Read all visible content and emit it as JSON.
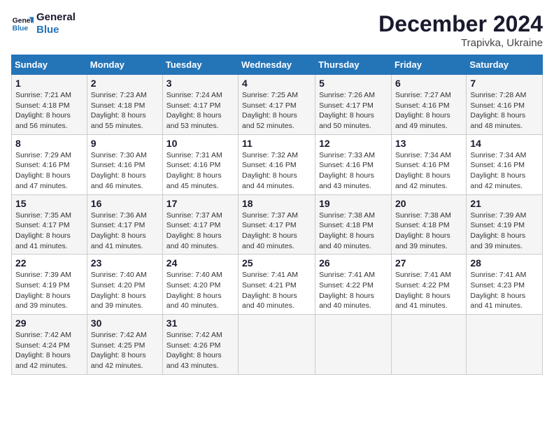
{
  "logo": {
    "line1": "General",
    "line2": "Blue"
  },
  "title": "December 2024",
  "subtitle": "Trapivka, Ukraine",
  "days_of_week": [
    "Sunday",
    "Monday",
    "Tuesday",
    "Wednesday",
    "Thursday",
    "Friday",
    "Saturday"
  ],
  "weeks": [
    [
      {
        "day": "1",
        "sunrise": "7:21 AM",
        "sunset": "4:18 PM",
        "daylight": "8 hours and 56 minutes."
      },
      {
        "day": "2",
        "sunrise": "7:23 AM",
        "sunset": "4:18 PM",
        "daylight": "8 hours and 55 minutes."
      },
      {
        "day": "3",
        "sunrise": "7:24 AM",
        "sunset": "4:17 PM",
        "daylight": "8 hours and 53 minutes."
      },
      {
        "day": "4",
        "sunrise": "7:25 AM",
        "sunset": "4:17 PM",
        "daylight": "8 hours and 52 minutes."
      },
      {
        "day": "5",
        "sunrise": "7:26 AM",
        "sunset": "4:17 PM",
        "daylight": "8 hours and 50 minutes."
      },
      {
        "day": "6",
        "sunrise": "7:27 AM",
        "sunset": "4:16 PM",
        "daylight": "8 hours and 49 minutes."
      },
      {
        "day": "7",
        "sunrise": "7:28 AM",
        "sunset": "4:16 PM",
        "daylight": "8 hours and 48 minutes."
      }
    ],
    [
      {
        "day": "8",
        "sunrise": "7:29 AM",
        "sunset": "4:16 PM",
        "daylight": "8 hours and 47 minutes."
      },
      {
        "day": "9",
        "sunrise": "7:30 AM",
        "sunset": "4:16 PM",
        "daylight": "8 hours and 46 minutes."
      },
      {
        "day": "10",
        "sunrise": "7:31 AM",
        "sunset": "4:16 PM",
        "daylight": "8 hours and 45 minutes."
      },
      {
        "day": "11",
        "sunrise": "7:32 AM",
        "sunset": "4:16 PM",
        "daylight": "8 hours and 44 minutes."
      },
      {
        "day": "12",
        "sunrise": "7:33 AM",
        "sunset": "4:16 PM",
        "daylight": "8 hours and 43 minutes."
      },
      {
        "day": "13",
        "sunrise": "7:34 AM",
        "sunset": "4:16 PM",
        "daylight": "8 hours and 42 minutes."
      },
      {
        "day": "14",
        "sunrise": "7:34 AM",
        "sunset": "4:16 PM",
        "daylight": "8 hours and 42 minutes."
      }
    ],
    [
      {
        "day": "15",
        "sunrise": "7:35 AM",
        "sunset": "4:17 PM",
        "daylight": "8 hours and 41 minutes."
      },
      {
        "day": "16",
        "sunrise": "7:36 AM",
        "sunset": "4:17 PM",
        "daylight": "8 hours and 41 minutes."
      },
      {
        "day": "17",
        "sunrise": "7:37 AM",
        "sunset": "4:17 PM",
        "daylight": "8 hours and 40 minutes."
      },
      {
        "day": "18",
        "sunrise": "7:37 AM",
        "sunset": "4:17 PM",
        "daylight": "8 hours and 40 minutes."
      },
      {
        "day": "19",
        "sunrise": "7:38 AM",
        "sunset": "4:18 PM",
        "daylight": "8 hours and 40 minutes."
      },
      {
        "day": "20",
        "sunrise": "7:38 AM",
        "sunset": "4:18 PM",
        "daylight": "8 hours and 39 minutes."
      },
      {
        "day": "21",
        "sunrise": "7:39 AM",
        "sunset": "4:19 PM",
        "daylight": "8 hours and 39 minutes."
      }
    ],
    [
      {
        "day": "22",
        "sunrise": "7:39 AM",
        "sunset": "4:19 PM",
        "daylight": "8 hours and 39 minutes."
      },
      {
        "day": "23",
        "sunrise": "7:40 AM",
        "sunset": "4:20 PM",
        "daylight": "8 hours and 39 minutes."
      },
      {
        "day": "24",
        "sunrise": "7:40 AM",
        "sunset": "4:20 PM",
        "daylight": "8 hours and 40 minutes."
      },
      {
        "day": "25",
        "sunrise": "7:41 AM",
        "sunset": "4:21 PM",
        "daylight": "8 hours and 40 minutes."
      },
      {
        "day": "26",
        "sunrise": "7:41 AM",
        "sunset": "4:22 PM",
        "daylight": "8 hours and 40 minutes."
      },
      {
        "day": "27",
        "sunrise": "7:41 AM",
        "sunset": "4:22 PM",
        "daylight": "8 hours and 41 minutes."
      },
      {
        "day": "28",
        "sunrise": "7:41 AM",
        "sunset": "4:23 PM",
        "daylight": "8 hours and 41 minutes."
      }
    ],
    [
      {
        "day": "29",
        "sunrise": "7:42 AM",
        "sunset": "4:24 PM",
        "daylight": "8 hours and 42 minutes."
      },
      {
        "day": "30",
        "sunrise": "7:42 AM",
        "sunset": "4:25 PM",
        "daylight": "8 hours and 42 minutes."
      },
      {
        "day": "31",
        "sunrise": "7:42 AM",
        "sunset": "4:26 PM",
        "daylight": "8 hours and 43 minutes."
      },
      null,
      null,
      null,
      null
    ]
  ],
  "labels": {
    "sunrise": "Sunrise:",
    "sunset": "Sunset:",
    "daylight": "Daylight:"
  }
}
